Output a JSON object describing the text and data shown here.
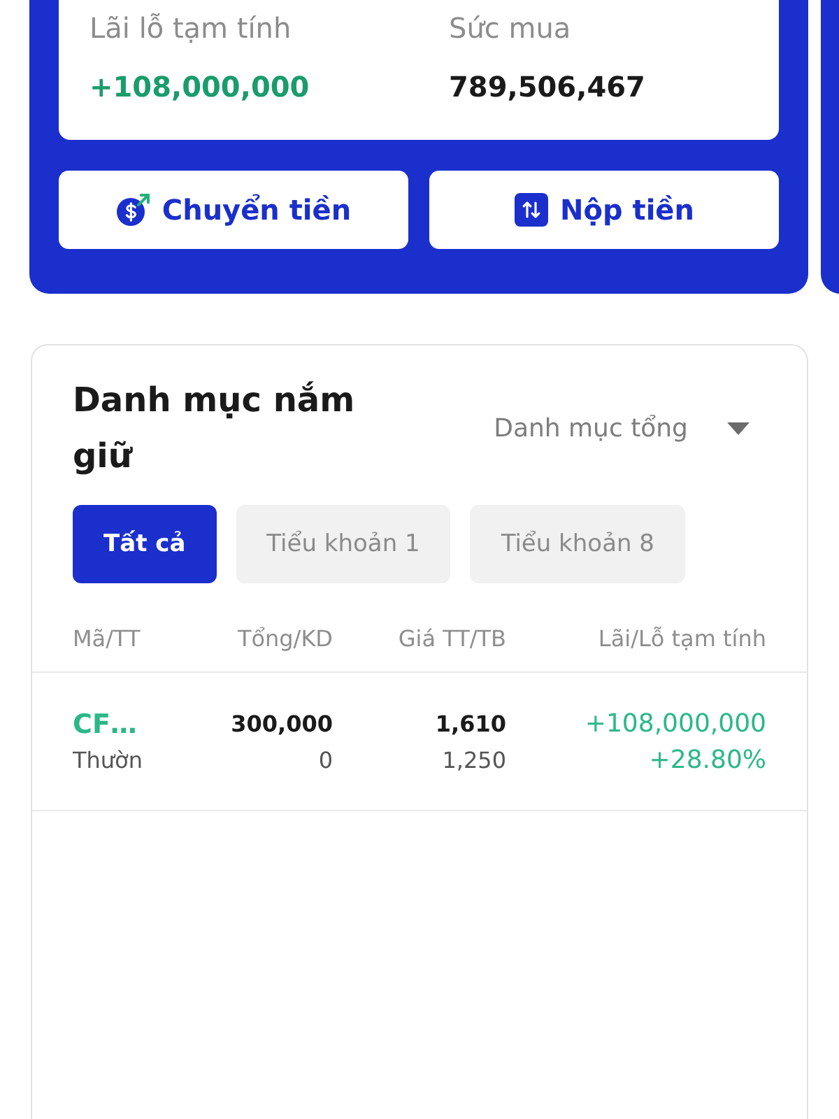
{
  "summary": [
    {
      "label": "Lãi lỗ tạm tính",
      "value": "+108,000,000",
      "kind": "gain"
    },
    {
      "label": "Sức mua",
      "value": "789,506,467",
      "kind": "plain"
    }
  ],
  "actions": [
    {
      "label": "Chuyển tiền",
      "kind": "transfer"
    },
    {
      "label": "Nộp tiền",
      "kind": "deposit"
    }
  ],
  "holdings": {
    "title": "Danh mục nắm giữ",
    "filter": "Danh mục tổng",
    "tabs": [
      {
        "label": "Tất cả",
        "selected": true
      },
      {
        "label": "Tiểu khoản 1",
        "selected": false
      },
      {
        "label": "Tiểu khoản 8",
        "selected": false
      }
    ],
    "table": {
      "columns": [
        "Mã/TT",
        "Tổng/KD",
        "Giá TT/TB",
        "Lãi/Lỗ tạm tính"
      ],
      "rows": [
        {
          "code": "CF…",
          "type": "Thườn",
          "total": "300,000",
          "available": "0",
          "price": "1,610",
          "avg_price": "1,250",
          "pnl": "+108,000,000",
          "pnl_percent": "+28.80%",
          "positive": true
        }
      ]
    }
  }
}
